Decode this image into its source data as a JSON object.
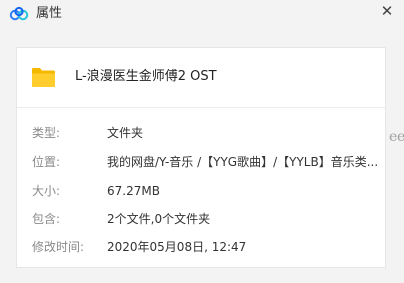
{
  "window": {
    "title": "属性",
    "close_glyph": "✕",
    "app_icon": "cloud-logo-icon",
    "close_icon": "close-icon"
  },
  "file": {
    "icon": "folder-icon",
    "name": "L-浪漫医生金师傅2 OST"
  },
  "properties": [
    {
      "label": "类型:",
      "value": "文件夹"
    },
    {
      "label": "位置:",
      "value": "我的网盘/Y-音乐 /【YYG歌曲】/【YYLB】音乐类..."
    },
    {
      "label": "大小:",
      "value": "67.27MB"
    },
    {
      "label": "包含:",
      "value": "2个文件,0个文件夹"
    },
    {
      "label": "修改时间:",
      "value": "2020年05月08日, 12:47"
    }
  ],
  "background_fragment": "eet",
  "colors": {
    "window_bg": "#f3f3f3",
    "panel_bg": "#ffffff",
    "folder_yellow": "#f7c325",
    "logo_blue": "#2f7df6"
  }
}
